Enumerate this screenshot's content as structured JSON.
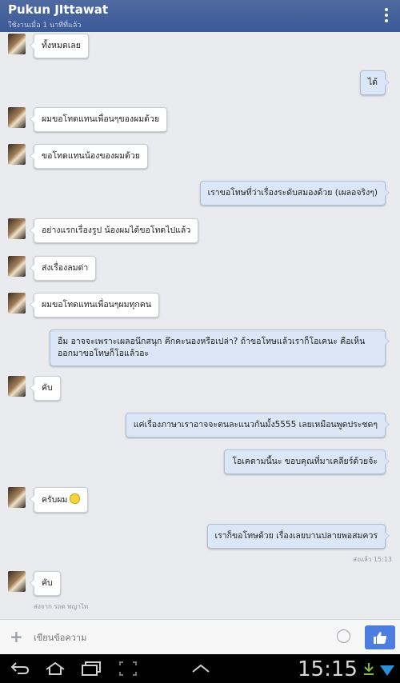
{
  "header": {
    "title": "Pukun JIttawat",
    "status": "ใช้งานเมื่อ 1 นาทีที่แล้ว"
  },
  "messages": [
    {
      "dir": "in",
      "text": "ทั้งหมดเลย"
    },
    {
      "dir": "out",
      "text": "ได้"
    },
    {
      "dir": "in",
      "text": "ผมขอโทดแทนเพื่อนๆของผมด้วย"
    },
    {
      "dir": "in",
      "text": "ขอโทดแทนน้องของผมด้วย"
    },
    {
      "dir": "out",
      "text": "เราขอโทษที่ว่าเรื่องระดับสมองด้วย (เผลอจริงๆ)"
    },
    {
      "dir": "in",
      "text": "อย่างแรกเรื่องรูป น้องผมได้ขอโทดไปแล้ว"
    },
    {
      "dir": "in",
      "text": "ส่งเรื่องลมด่า"
    },
    {
      "dir": "in",
      "text": "ผมขอโทดแทนเพื่อนๆผมทุกคน"
    },
    {
      "dir": "out",
      "text": "อืม อาจจะเพราะเผลอนึกสนุก คึกคะนองหรือเปล่า? ถ้าขอโทษแล้วเราก็โอเคนะ คือเห็นออกมาขอโทษก็โอแล้วอะ"
    },
    {
      "dir": "in",
      "text": "คับ"
    },
    {
      "dir": "out",
      "text": "แค่เรื่องภาษาเราอาจจะตนละแนวกันมั้ง5555 เลยเหมือนพูดประชดๆ"
    },
    {
      "dir": "out",
      "text": "โอเคตามนี้นะ ขอบคุณที่มาเคลียร์ด้วยจ้ะ"
    },
    {
      "dir": "in",
      "text": "ครับผม",
      "emoji": "smiley-icon"
    },
    {
      "dir": "out",
      "text": "เราก็ขอโทษด้วย เรื่องเลยบานปลายพอสมควร"
    },
    {
      "dir": "in",
      "text": "คับ"
    }
  ],
  "meta": {
    "seen": "ส่งแล้ว 15:13",
    "sent_via": "ส่งจาก รถด พญาไท"
  },
  "composer": {
    "placeholder": "เขียนข้อความ"
  },
  "systembar": {
    "clock": "15:15"
  },
  "colors": {
    "header": "#3b5998",
    "outgoing_bubble": "#dbe6f7",
    "like_button": "#4b7ee0"
  }
}
